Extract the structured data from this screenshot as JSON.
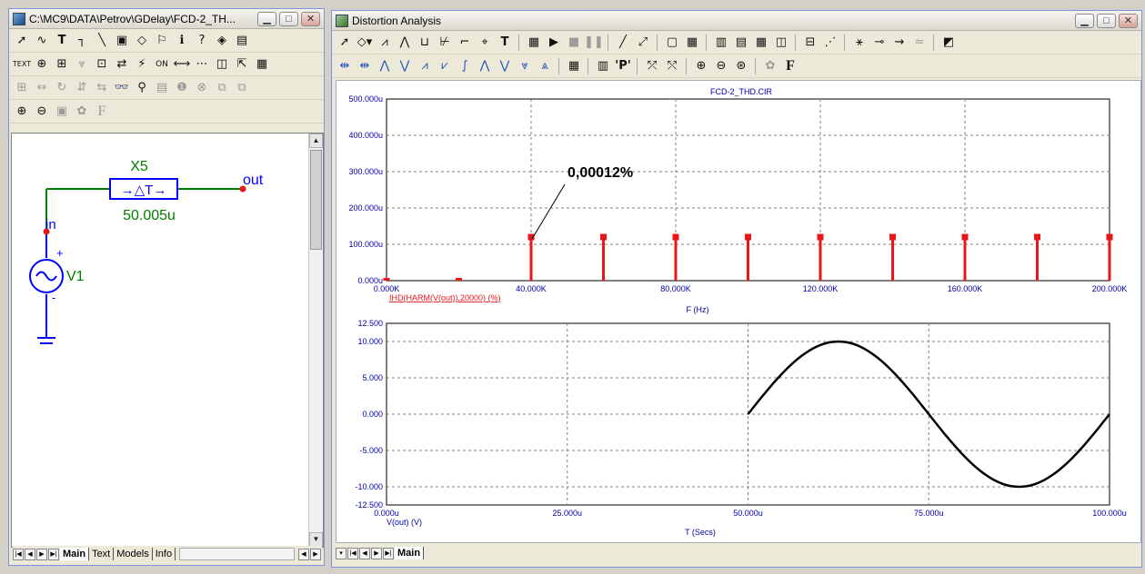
{
  "schematic_window": {
    "title": "C:\\MC9\\DATA\\Petrov\\GDelay\\FCD-2_TH...",
    "labels": {
      "part": "X5",
      "delay_symbol": "→△T→",
      "delay_value": "50.005u",
      "node_out": "out",
      "node_in": "in",
      "source": "V1",
      "plus": "+",
      "minus": "-"
    },
    "tabs": [
      "Main",
      "Text",
      "Models",
      "Info"
    ],
    "active_tab": "Main"
  },
  "analysis_window": {
    "title": "Distortion Analysis",
    "tabs": [
      "Main"
    ],
    "active_tab": "Main",
    "harmonics_plot": {
      "title": "FCD-2_THD.CIR",
      "y_ticks": [
        "500.000u",
        "400.000u",
        "300.000u",
        "200.000u",
        "100.000u",
        "0.000u"
      ],
      "x_ticks": [
        "0.000K",
        "40.000K",
        "80.000K",
        "120.000K",
        "160.000K",
        "200.000K"
      ],
      "trace_label": "IHD(HARM(V(out)),20000) (%)",
      "x_label": "F (Hz)",
      "annotation": "0,00012%"
    },
    "time_plot": {
      "y_ticks": [
        "12.500",
        "10.000",
        "5.000",
        "0.000",
        "-5.000",
        "-10.000",
        "-12.500"
      ],
      "x_ticks": [
        "0.000u",
        "25.000u",
        "50.000u",
        "75.000u",
        "100.000u"
      ],
      "trace_label": "V(out) (V)",
      "x_label": "T (Secs)"
    }
  },
  "colors": {
    "axis_text": "#0000aa",
    "grid": "#808080",
    "harmonic": "#e8161a",
    "wire": "#008000",
    "component": "#0000ff",
    "node": "#e8161a",
    "trace": "#000000"
  },
  "chart_data": [
    {
      "type": "bar",
      "title": "FCD-2_THD.CIR",
      "xlabel": "F (Hz)",
      "ylabel": "IHD(HARM(V(out)),20000) (%)",
      "xlim": [
        0,
        200000
      ],
      "ylim": [
        0,
        0.0005
      ],
      "x": [
        0,
        20000,
        40000,
        60000,
        80000,
        100000,
        120000,
        140000,
        160000,
        180000,
        200000
      ],
      "values": [
        1.5e-06,
        2e-06,
        0.00012,
        0.00012,
        0.00012,
        0.00012,
        0.00012,
        0.00012,
        0.00012,
        0.00012,
        0.00012
      ],
      "grid": true
    },
    {
      "type": "line",
      "xlabel": "T (Secs)",
      "ylabel": "V(out) (V)",
      "xlim": [
        0,
        0.0001
      ],
      "ylim": [
        -12.5,
        12.5
      ],
      "series": [
        {
          "name": "V(out) (V)",
          "x": [
            5e-05,
            6.25e-05,
            7.5e-05,
            8.75e-05,
            0.0001
          ],
          "values": [
            0,
            10,
            0,
            -10,
            0
          ]
        }
      ],
      "grid": true
    }
  ]
}
